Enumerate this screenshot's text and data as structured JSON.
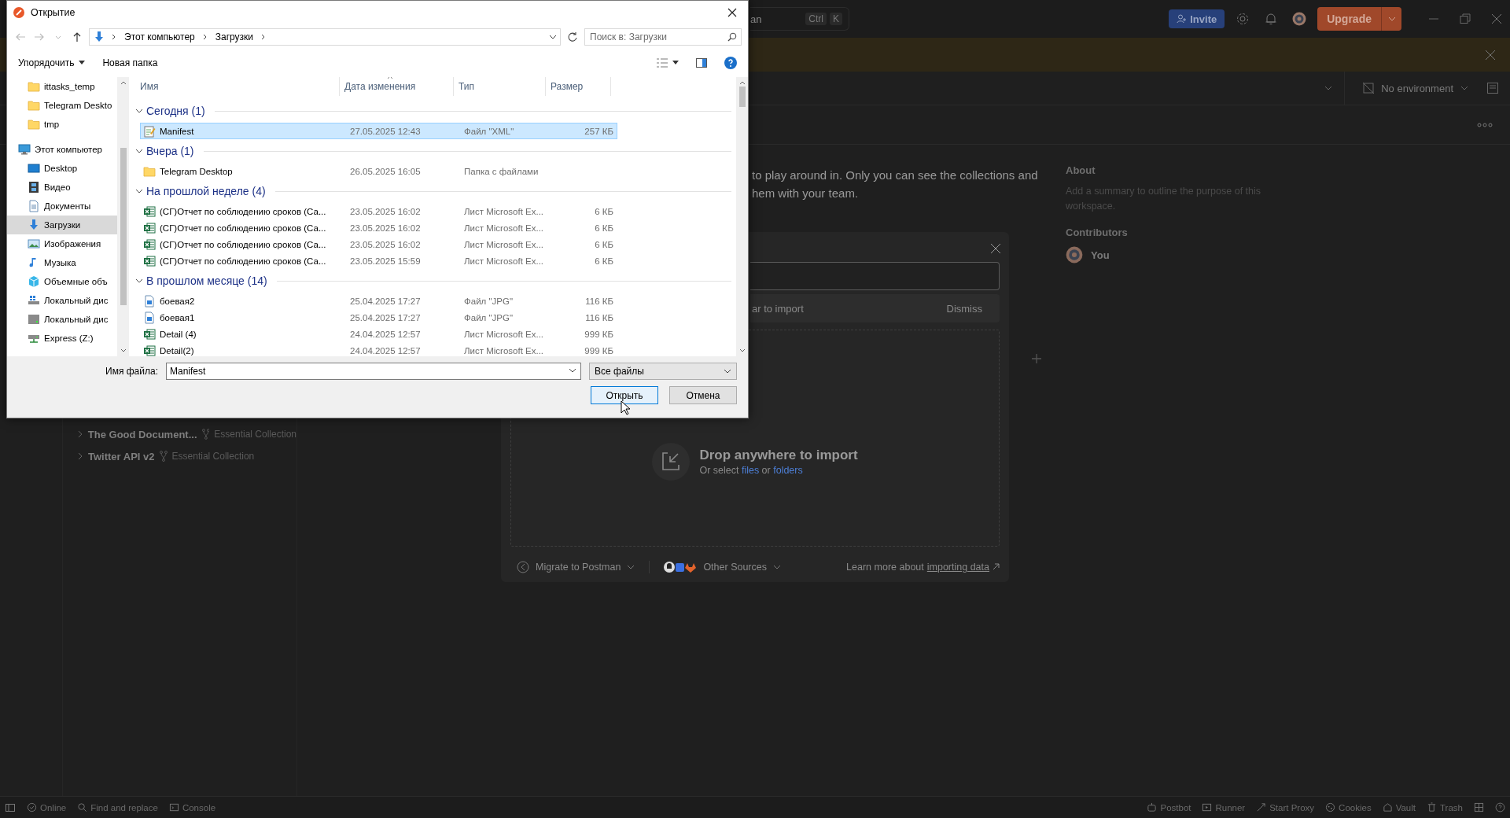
{
  "dialog": {
    "title": "Открытие",
    "path": [
      "Этот компьютер",
      "Загрузки"
    ],
    "search": {
      "placeholder": "Поиск в: Загрузки"
    },
    "toolbar": [
      "Упорядочить",
      "Новая папка"
    ],
    "nav": {
      "quick_access": [
        {
          "label": "ittasks_temp",
          "kind": "folder",
          "selected": false
        },
        {
          "label": "Telegram Deskto",
          "kind": "folder",
          "selected": false
        },
        {
          "label": "tmp",
          "kind": "folder",
          "selected": false
        }
      ],
      "tree": [
        {
          "label": "Этот компьютер",
          "kind": "computer",
          "selected": false,
          "children": [
            {
              "label": "Desktop",
              "kind": "desktop",
              "selected": false
            },
            {
              "label": "Видео",
              "kind": "video",
              "selected": false
            },
            {
              "label": "Документы",
              "kind": "documents",
              "selected": false
            },
            {
              "label": "Загрузки",
              "kind": "downloads",
              "selected": true
            },
            {
              "label": "Изображения",
              "kind": "pictures",
              "selected": false
            },
            {
              "label": "Музыка",
              "kind": "music",
              "selected": false
            },
            {
              "label": "Объемные объ",
              "kind": "objects",
              "selected": false
            },
            {
              "label": "Локальный дис",
              "kind": "drive_os",
              "selected": false
            },
            {
              "label": "Локальный дис",
              "kind": "drive",
              "selected": false
            },
            {
              "label": "Express (Z:)",
              "kind": "network_drive",
              "selected": false
            }
          ]
        }
      ]
    },
    "columns": [
      "Имя",
      "Дата изменения",
      "Тип",
      "Размер"
    ],
    "groups": [
      {
        "label": "Сегодня (1)",
        "expanded": true,
        "files": [
          {
            "name": "Manifest",
            "date": "27.05.2025 12:43",
            "type": "Файл \"XML\"",
            "size": "257 КБ",
            "kind": "xml",
            "selected": true
          }
        ]
      },
      {
        "label": "Вчера (1)",
        "expanded": true,
        "files": [
          {
            "name": "Telegram Desktop",
            "date": "26.05.2025 16:05",
            "type": "Папка с файлами",
            "kind": "folder",
            "selected": false
          }
        ]
      },
      {
        "label": "На прошлой неделе (4)",
        "expanded": true,
        "files": [
          {
            "name": "(СГ)Отчет по соблюдению сроков (Са...",
            "date": "23.05.2025 16:02",
            "type": "Лист Microsoft Ex...",
            "size": "6 КБ",
            "kind": "excel",
            "selected": false
          },
          {
            "name": "(СГ)Отчет по соблюдению сроков (Са...",
            "date": "23.05.2025 16:02",
            "type": "Лист Microsoft Ex...",
            "size": "6 КБ",
            "kind": "excel",
            "selected": false
          },
          {
            "name": "(СГ)Отчет по соблюдению сроков (Са...",
            "date": "23.05.2025 16:02",
            "type": "Лист Microsoft Ex...",
            "size": "6 КБ",
            "kind": "excel",
            "selected": false
          },
          {
            "name": "(СГ)Отчет по соблюдению сроков (Са...",
            "date": "23.05.2025 15:59",
            "type": "Лист Microsoft Ex...",
            "size": "6 КБ",
            "kind": "excel",
            "selected": false
          }
        ]
      },
      {
        "label": "В прошлом месяце (14)",
        "expanded": true,
        "files": [
          {
            "name": "боевая2",
            "date": "25.04.2025 17:27",
            "type": "Файл \"JPG\"",
            "size": "116 КБ",
            "kind": "jpg",
            "selected": false
          },
          {
            "name": "боевая1",
            "date": "25.04.2025 17:27",
            "type": "Файл \"JPG\"",
            "size": "116 КБ",
            "kind": "jpg",
            "selected": false
          },
          {
            "name": "Detail (4)",
            "date": "24.04.2025 12:57",
            "type": "Лист Microsoft Ex...",
            "size": "999 КБ",
            "kind": "excel",
            "selected": false
          },
          {
            "name": "Detail(2)",
            "date": "24.04.2025 12:57",
            "type": "Лист Microsoft Ex...",
            "size": "999 КБ",
            "kind": "excel",
            "selected": false
          }
        ]
      }
    ],
    "filename_label": "Имя файла:",
    "filename": "Manifest",
    "filter": "Все файлы",
    "buttons": [
      {
        "label": "Открыть",
        "kind": "default"
      },
      {
        "label": "Отмена",
        "kind": "normal"
      }
    ]
  },
  "postman": {
    "search": {
      "text": "an",
      "shortcut": [
        "Ctrl",
        "K"
      ]
    },
    "invite": "Invite",
    "upgrade": "Upgrade",
    "environment": "No environment",
    "collections": [
      {
        "name": "The Good Document...",
        "tag": "Essential Collection"
      },
      {
        "name": "Twitter API v2",
        "tag": "Essential Collection"
      }
    ],
    "description": [
      "to play around in. Only you can see the collections and",
      "hem with your team."
    ],
    "about": {
      "title": "About",
      "summary": "Add a summary to outline the purpose of this workspace.",
      "contributors_title": "Contributors",
      "contributors": [
        {
          "name": "You"
        }
      ]
    },
    "import": {
      "hint": "ar to import",
      "dismiss": "Dismiss",
      "drop_title": "Drop anywhere to import",
      "drop_text": "Or select",
      "drop_links": [
        "files",
        "folders"
      ],
      "drop_joiner": "or",
      "migrate": "Migrate to Postman",
      "other_sources": "Other Sources",
      "learn_more": "Learn more about",
      "learn_link": "importing data"
    },
    "status_left": [
      {
        "label": "Online",
        "kind": "online"
      },
      {
        "label": "Find and replace",
        "kind": "search"
      },
      {
        "label": "Console",
        "kind": "console"
      }
    ],
    "status_right": [
      {
        "label": "Postbot",
        "kind": "postbot"
      },
      {
        "label": "Runner",
        "kind": "runner"
      },
      {
        "label": "Start Proxy",
        "kind": "proxy"
      },
      {
        "label": "Cookies",
        "kind": "cookies"
      },
      {
        "label": "Vault",
        "kind": "vault"
      },
      {
        "label": "Trash",
        "kind": "trash"
      }
    ]
  }
}
